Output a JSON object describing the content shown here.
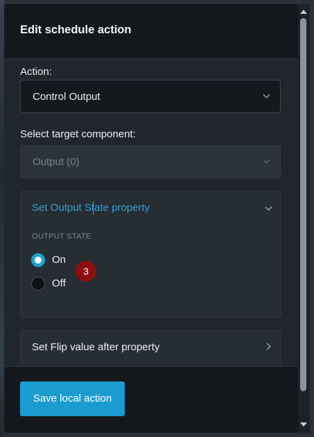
{
  "modal": {
    "title": "Edit schedule action"
  },
  "action": {
    "label": "Action:",
    "value": "Control Output"
  },
  "target": {
    "label": "Select target component:",
    "value": "Output (0)"
  },
  "output_state_panel": {
    "title": "Set Output State property",
    "group_label": "OUTPUT STATE",
    "options": [
      {
        "label": "On",
        "checked": true
      },
      {
        "label": "Off",
        "checked": false
      }
    ]
  },
  "step_badge": "3",
  "flip_panel": {
    "title": "Set Flip value after property"
  },
  "footer": {
    "save_label": "Save local action"
  },
  "colors": {
    "accent": "#1a9cd0",
    "badge": "#8c0e10",
    "header_bg": "#14181c",
    "body_bg": "#20262c"
  },
  "icons": {
    "dropdown": "chevron-down-icon",
    "expand": "chevron-right-icon"
  }
}
